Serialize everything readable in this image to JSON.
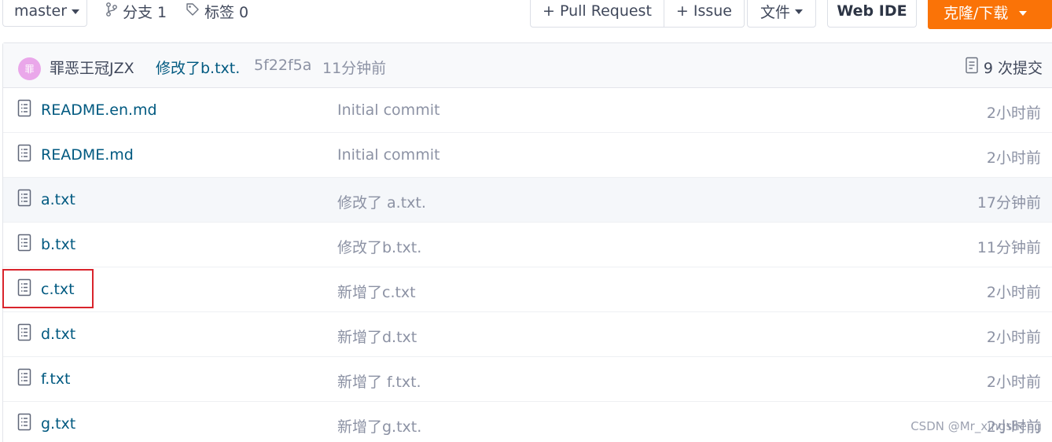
{
  "toolbar": {
    "branch": "master",
    "branches_label": "分支 1",
    "tags_label": "标签 0",
    "pull_request": "+ Pull Request",
    "issue": "+ Issue",
    "files": "文件",
    "web_ide": "Web IDE",
    "clone": "克隆/下载"
  },
  "latest_commit": {
    "avatar_text": "罪",
    "author": "罪恶王冠JZX",
    "message": "修改了b.txt.",
    "sha": "5f22f5a",
    "time": "11分钟前",
    "count": "9 次提交"
  },
  "files": [
    {
      "name": "README.en.md",
      "message": "Initial commit",
      "time": "2小时前"
    },
    {
      "name": "README.md",
      "message": "Initial commit",
      "time": "2小时前"
    },
    {
      "name": "a.txt",
      "message": "修改了 a.txt.",
      "time": "17分钟前"
    },
    {
      "name": "b.txt",
      "message": "修改了b.txt.",
      "time": "11分钟前"
    },
    {
      "name": "c.txt",
      "message": "新增了c.txt",
      "time": "2小时前"
    },
    {
      "name": "d.txt",
      "message": "新增了d.txt",
      "time": "2小时前"
    },
    {
      "name": "f.txt",
      "message": "新增了 f.txt.",
      "time": "2小时前"
    },
    {
      "name": "g.txt",
      "message": "新增了g.txt.",
      "time": "2小时前"
    }
  ],
  "watermark": "CSDN @Mr_xingsheng",
  "colors": {
    "accent": "#fa7307",
    "link": "#005980",
    "muted": "#8c92a4",
    "highlight": "#d9242c",
    "avatar": "#eaa7ea"
  },
  "icons": {
    "branch": "branch-icon",
    "tag": "tag-icon",
    "file": "file-icon",
    "commits": "commit-history-icon"
  }
}
